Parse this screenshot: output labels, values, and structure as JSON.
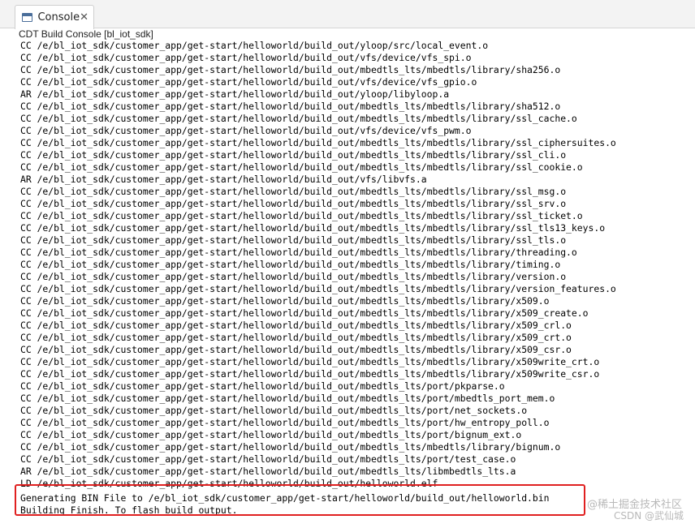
{
  "tab": {
    "label": "Console",
    "close": "✕"
  },
  "console": {
    "title": "CDT Build Console [bl_iot_sdk]",
    "lines": [
      "CC /e/bl_iot_sdk/customer_app/get-start/helloworld/build_out/yloop/src/local_event.o",
      "CC /e/bl_iot_sdk/customer_app/get-start/helloworld/build_out/vfs/device/vfs_spi.o",
      "CC /e/bl_iot_sdk/customer_app/get-start/helloworld/build_out/mbedtls_lts/mbedtls/library/sha256.o",
      "CC /e/bl_iot_sdk/customer_app/get-start/helloworld/build_out/vfs/device/vfs_gpio.o",
      "AR /e/bl_iot_sdk/customer_app/get-start/helloworld/build_out/yloop/libyloop.a",
      "CC /e/bl_iot_sdk/customer_app/get-start/helloworld/build_out/mbedtls_lts/mbedtls/library/sha512.o",
      "CC /e/bl_iot_sdk/customer_app/get-start/helloworld/build_out/mbedtls_lts/mbedtls/library/ssl_cache.o",
      "CC /e/bl_iot_sdk/customer_app/get-start/helloworld/build_out/vfs/device/vfs_pwm.o",
      "CC /e/bl_iot_sdk/customer_app/get-start/helloworld/build_out/mbedtls_lts/mbedtls/library/ssl_ciphersuites.o",
      "CC /e/bl_iot_sdk/customer_app/get-start/helloworld/build_out/mbedtls_lts/mbedtls/library/ssl_cli.o",
      "CC /e/bl_iot_sdk/customer_app/get-start/helloworld/build_out/mbedtls_lts/mbedtls/library/ssl_cookie.o",
      "AR /e/bl_iot_sdk/customer_app/get-start/helloworld/build_out/vfs/libvfs.a",
      "CC /e/bl_iot_sdk/customer_app/get-start/helloworld/build_out/mbedtls_lts/mbedtls/library/ssl_msg.o",
      "CC /e/bl_iot_sdk/customer_app/get-start/helloworld/build_out/mbedtls_lts/mbedtls/library/ssl_srv.o",
      "CC /e/bl_iot_sdk/customer_app/get-start/helloworld/build_out/mbedtls_lts/mbedtls/library/ssl_ticket.o",
      "CC /e/bl_iot_sdk/customer_app/get-start/helloworld/build_out/mbedtls_lts/mbedtls/library/ssl_tls13_keys.o",
      "CC /e/bl_iot_sdk/customer_app/get-start/helloworld/build_out/mbedtls_lts/mbedtls/library/ssl_tls.o",
      "CC /e/bl_iot_sdk/customer_app/get-start/helloworld/build_out/mbedtls_lts/mbedtls/library/threading.o",
      "CC /e/bl_iot_sdk/customer_app/get-start/helloworld/build_out/mbedtls_lts/mbedtls/library/timing.o",
      "CC /e/bl_iot_sdk/customer_app/get-start/helloworld/build_out/mbedtls_lts/mbedtls/library/version.o",
      "CC /e/bl_iot_sdk/customer_app/get-start/helloworld/build_out/mbedtls_lts/mbedtls/library/version_features.o",
      "CC /e/bl_iot_sdk/customer_app/get-start/helloworld/build_out/mbedtls_lts/mbedtls/library/x509.o",
      "CC /e/bl_iot_sdk/customer_app/get-start/helloworld/build_out/mbedtls_lts/mbedtls/library/x509_create.o",
      "CC /e/bl_iot_sdk/customer_app/get-start/helloworld/build_out/mbedtls_lts/mbedtls/library/x509_crl.o",
      "CC /e/bl_iot_sdk/customer_app/get-start/helloworld/build_out/mbedtls_lts/mbedtls/library/x509_crt.o",
      "CC /e/bl_iot_sdk/customer_app/get-start/helloworld/build_out/mbedtls_lts/mbedtls/library/x509_csr.o",
      "CC /e/bl_iot_sdk/customer_app/get-start/helloworld/build_out/mbedtls_lts/mbedtls/library/x509write_crt.o",
      "CC /e/bl_iot_sdk/customer_app/get-start/helloworld/build_out/mbedtls_lts/mbedtls/library/x509write_csr.o",
      "CC /e/bl_iot_sdk/customer_app/get-start/helloworld/build_out/mbedtls_lts/port/pkparse.o",
      "CC /e/bl_iot_sdk/customer_app/get-start/helloworld/build_out/mbedtls_lts/port/mbedtls_port_mem.o",
      "CC /e/bl_iot_sdk/customer_app/get-start/helloworld/build_out/mbedtls_lts/port/net_sockets.o",
      "CC /e/bl_iot_sdk/customer_app/get-start/helloworld/build_out/mbedtls_lts/port/hw_entropy_poll.o",
      "CC /e/bl_iot_sdk/customer_app/get-start/helloworld/build_out/mbedtls_lts/port/bignum_ext.o",
      "CC /e/bl_iot_sdk/customer_app/get-start/helloworld/build_out/mbedtls_lts/mbedtls/library/bignum.o",
      "CC /e/bl_iot_sdk/customer_app/get-start/helloworld/build_out/mbedtls_lts/port/test_case.o",
      "AR /e/bl_iot_sdk/customer_app/get-start/helloworld/build_out/mbedtls_lts/libmbedtls_lts.a",
      "LD /e/bl_iot_sdk/customer_app/get-start/helloworld/build_out/helloworld.elf",
      "Generating BIN File to /e/bl_iot_sdk/customer_app/get-start/helloworld/build_out/helloworld.bin",
      "Building Finish. To flash build output."
    ]
  },
  "watermarks": {
    "juejin": "@稀土掘金技术社区",
    "csdn": "CSDN @武仙城"
  },
  "colors": {
    "highlight_border": "#e02020",
    "tab_icon": "#4a6e9a"
  }
}
